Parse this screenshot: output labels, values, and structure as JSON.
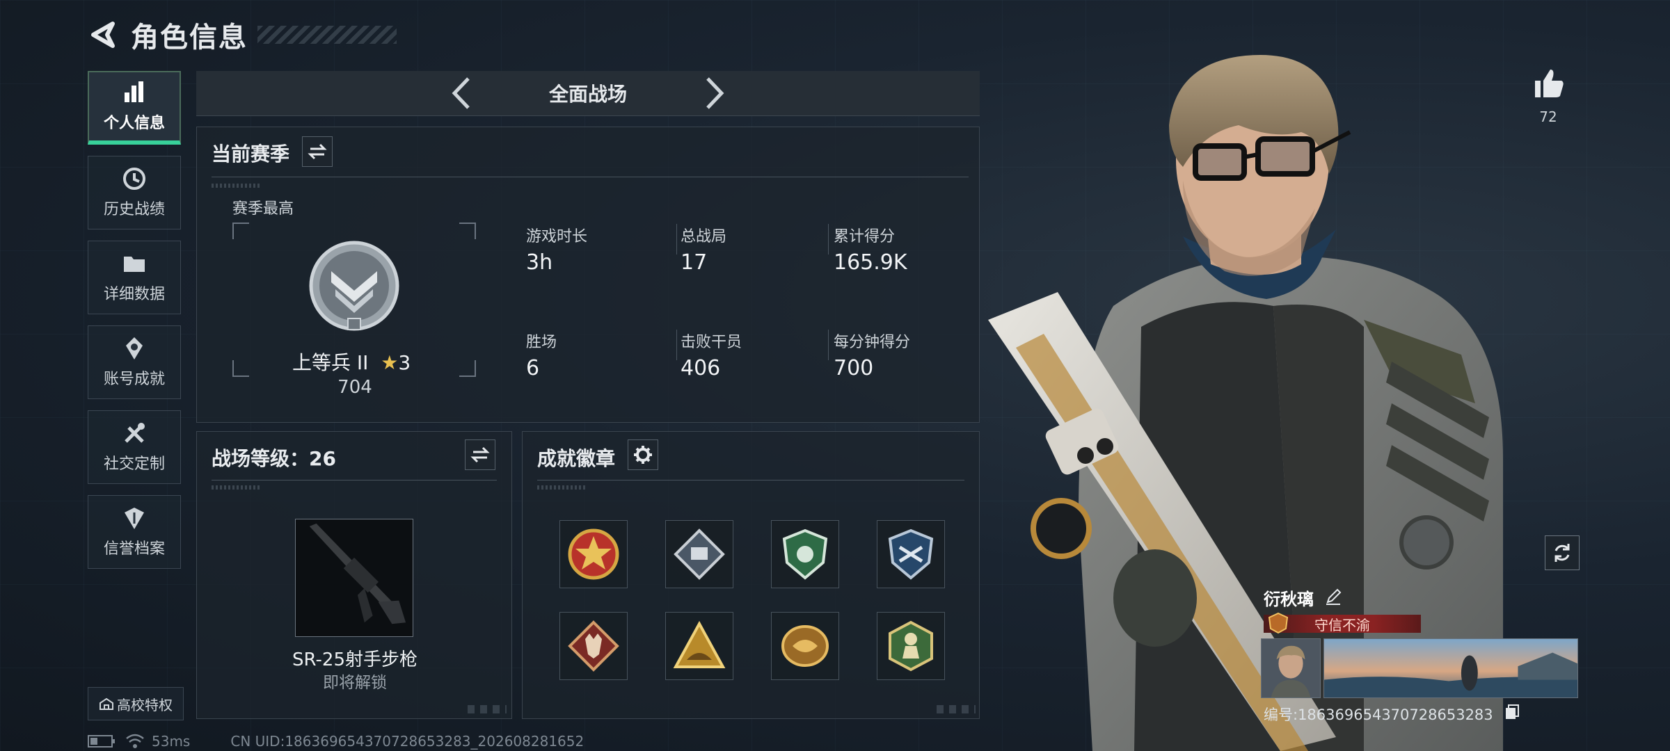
{
  "header": {
    "title": "角色信息"
  },
  "sidebar": {
    "items": [
      {
        "label": "个人信息",
        "icon": "bar-chart-icon",
        "active": true
      },
      {
        "label": "历史战绩",
        "icon": "history-icon"
      },
      {
        "label": "详细数据",
        "icon": "folder-icon"
      },
      {
        "label": "账号成就",
        "icon": "achievement-icon"
      },
      {
        "label": "社交定制",
        "icon": "tools-icon"
      },
      {
        "label": "信誉档案",
        "icon": "shield-icon"
      }
    ],
    "campus": "高校特权"
  },
  "mode": {
    "title": "全面战场"
  },
  "season": {
    "title": "当前赛季",
    "best_label": "赛季最高",
    "rank_name": "上等兵 II",
    "rank_stars": "3",
    "rank_score": "704",
    "stats": [
      {
        "label": "游戏时长",
        "value": "3h"
      },
      {
        "label": "总战局",
        "value": "17"
      },
      {
        "label": "累计得分",
        "value": "165.9K"
      },
      {
        "label": "胜场",
        "value": "6"
      },
      {
        "label": "击败干员",
        "value": "406"
      },
      {
        "label": "每分钟得分",
        "value": "700"
      }
    ]
  },
  "battle_level": {
    "title": "战场等级：26",
    "weapon_name": "SR-25射手步枪",
    "weapon_status": "即将解锁"
  },
  "achievements": {
    "title": "成就徽章",
    "medals": [
      "medal-star-badge",
      "medal-diamond-tank",
      "medal-green-shield",
      "medal-blue-cross",
      "medal-wolf",
      "medal-triangle",
      "medal-gold-beast",
      "medal-green-soldier"
    ]
  },
  "player": {
    "likes": "72",
    "name": "衍秋璃",
    "tag": "守信不渝",
    "id": "编号:1863696543707286532​83"
  },
  "status": {
    "ping": "53ms",
    "uid": "CN UID:18636965437072865328​3_202608281652"
  },
  "colors": {
    "accent": "#38d19a",
    "tag_red": "#8a2222",
    "star": "#e8c050"
  }
}
